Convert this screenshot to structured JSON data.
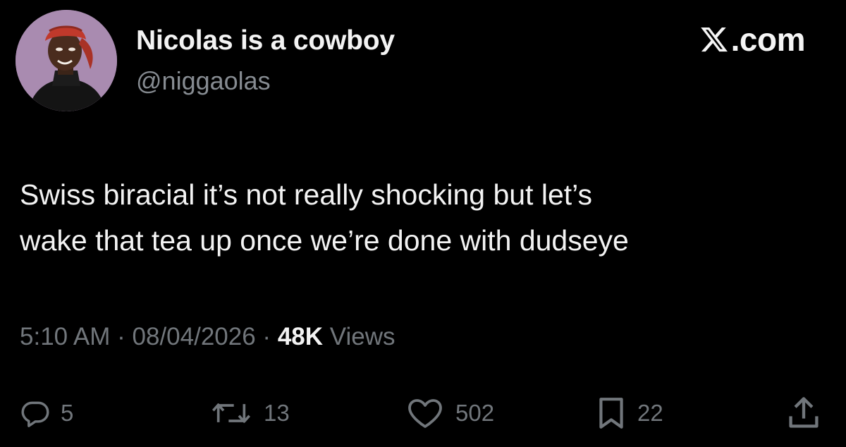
{
  "author": {
    "display_name": "Nicolas is a cowboy",
    "handle": "@niggaolas",
    "avatar_icon": "illustrated-portrait-red-bandana-avatar"
  },
  "brand": {
    "label": ".com",
    "icon": "x-logo-icon"
  },
  "tweet": {
    "lines": [
      "Swiss biracial it’s not really shocking but let’s",
      "wake that tea up once we’re done with dudseye"
    ]
  },
  "meta": {
    "time": "5:10 AM",
    "separator": " · ",
    "date": "08/04/2026",
    "views_count": "48K",
    "views_label": " Views"
  },
  "actions": {
    "replies": {
      "icon": "reply-bubble-icon",
      "count": "5"
    },
    "reposts": {
      "icon": "repost-icon",
      "count": "13"
    },
    "likes": {
      "icon": "heart-icon",
      "count": "502"
    },
    "bookmarks": {
      "icon": "bookmark-icon",
      "count": "22"
    },
    "share": {
      "icon": "share-upload-icon"
    }
  },
  "colors": {
    "background": "#000000",
    "primary_text": "#f3f3f3",
    "secondary_text": "#71767b",
    "avatar_background": "#a98bb0",
    "bandana_red": "#c0392b"
  }
}
